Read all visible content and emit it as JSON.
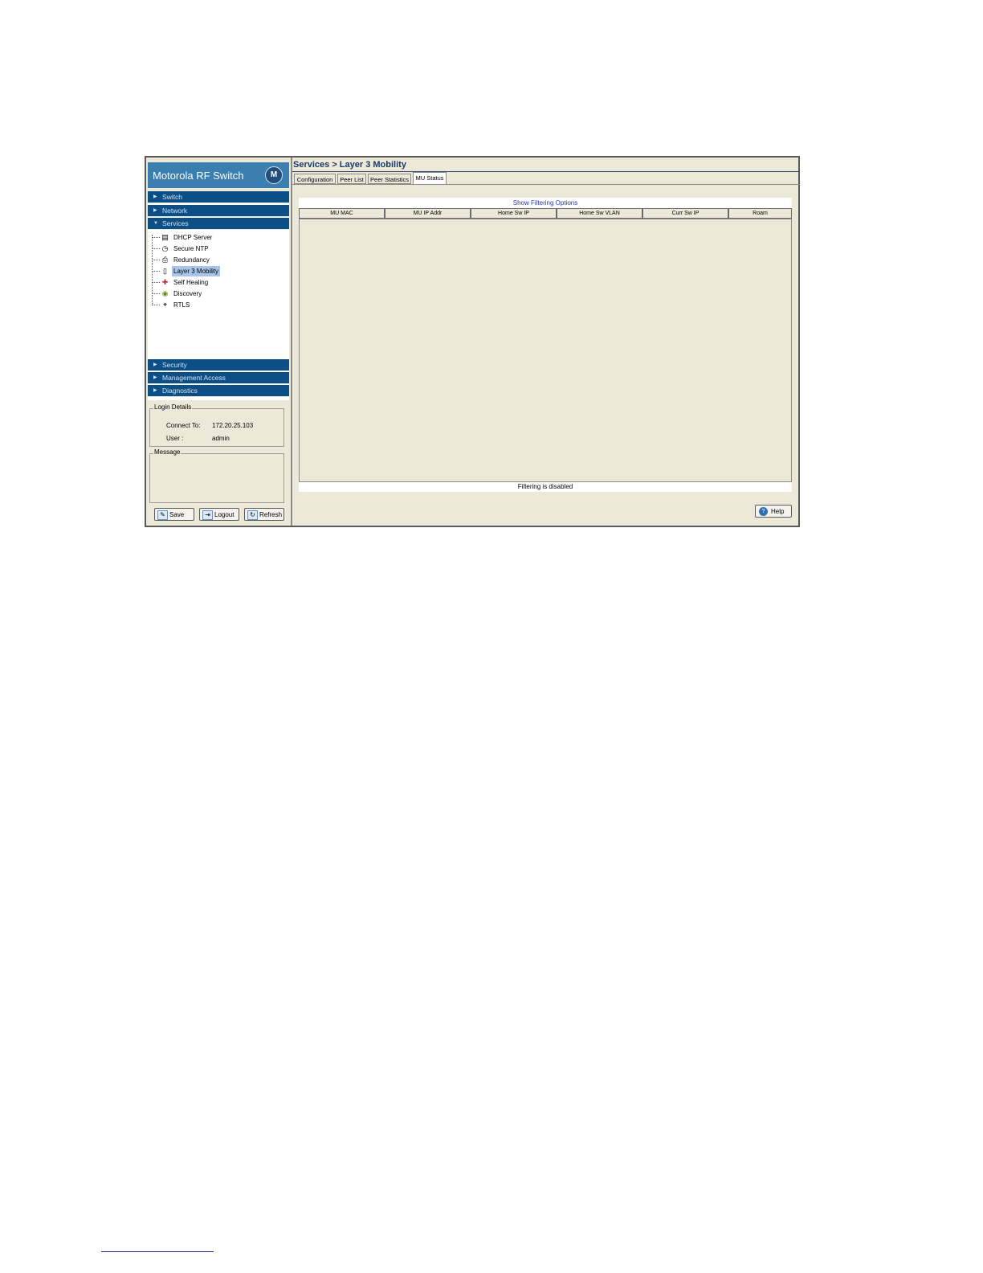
{
  "sidebar": {
    "brand": "Motorola RF Switch",
    "logo_glyph": "M",
    "nav": [
      {
        "label": "Switch",
        "arrow": "▶"
      },
      {
        "label": "Network",
        "arrow": "▶"
      },
      {
        "label": "Services",
        "arrow": "▼"
      },
      {
        "label": "Security",
        "arrow": "▶"
      },
      {
        "label": "Management Access",
        "arrow": "▶"
      },
      {
        "label": "Diagnostics",
        "arrow": "▶"
      }
    ],
    "tree": [
      {
        "label": "DHCP Server",
        "icon": "server-icon"
      },
      {
        "label": "Secure NTP",
        "icon": "clock-icon"
      },
      {
        "label": "Redundancy",
        "icon": "printer-icon"
      },
      {
        "label": "Layer 3 Mobility",
        "icon": "mobility-icon"
      },
      {
        "label": "Self Healing",
        "icon": "healing-icon"
      },
      {
        "label": "Discovery",
        "icon": "globe-icon"
      },
      {
        "label": "RTLS",
        "icon": "rtls-icon"
      }
    ],
    "login": {
      "legend": "Login Details",
      "connect_label": "Connect To:",
      "connect_value": "172.20.25.103",
      "user_label": "User :",
      "user_value": "admin"
    },
    "message_legend": "Message",
    "buttons": {
      "save": "Save",
      "logout": "Logout",
      "refresh": "Refresh"
    }
  },
  "main": {
    "title": "Services > Layer 3 Mobility",
    "tabs": [
      "Configuration",
      "Peer List",
      "Peer Statistics",
      "MU Status"
    ],
    "active_tab": "MU Status",
    "show_filter_link": "Show Filtering Options",
    "columns": [
      "MU MAC",
      "MU IP Addr",
      "Home Sw IP",
      "Home Sw VLAN",
      "Curr Sw IP",
      "Roam"
    ],
    "filter_status": "Filtering is disabled",
    "help_label": "Help"
  },
  "colors": {
    "nav_bg": "#0b4f86",
    "brand_bg": "#3a7fb0",
    "panel_bg": "#ece9d8",
    "link": "#2a3aa8",
    "selected": "#a9c4eb"
  }
}
